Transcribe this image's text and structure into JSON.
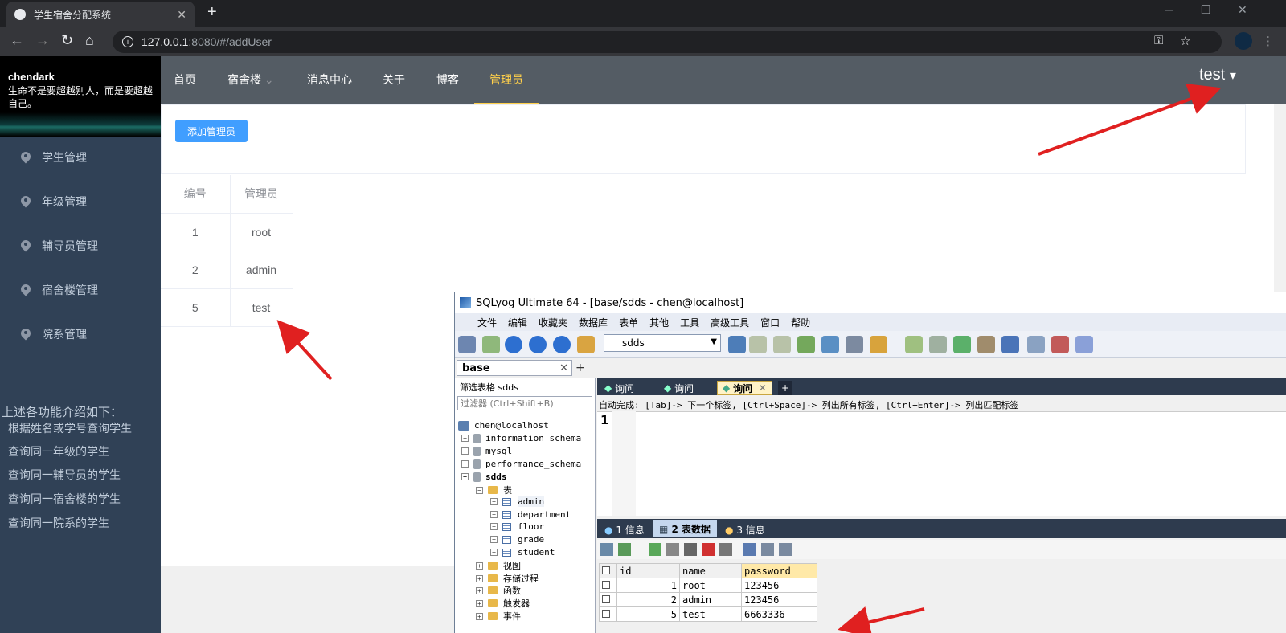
{
  "browser": {
    "tab_title": "学生宿舍分配系统",
    "tab_close": "✕",
    "new_tab": "+",
    "url_host": "127.0.0.1",
    "url_path": ":8080/#/addUser",
    "win_min": "─",
    "win_max": "❐",
    "win_close": "✕",
    "back": "←",
    "forward": "→",
    "reload": "↻",
    "home": "⌂",
    "key": "⚿",
    "star": "☆",
    "menu": "⋮"
  },
  "sidebar": {
    "brand": "chendark",
    "motto": "生命不是要超越别人，而是要超越自己。",
    "items": [
      {
        "label": "学生管理"
      },
      {
        "label": "年级管理"
      },
      {
        "label": "辅导员管理"
      },
      {
        "label": "宿舍楼管理"
      },
      {
        "label": "院系管理"
      }
    ],
    "intro": "上述各功能介绍如下：",
    "features": [
      "根据姓名或学号查询学生",
      "查询同一年级的学生",
      "查询同一辅导员的学生",
      "查询同一宿舍楼的学生",
      "查询同一院系的学生"
    ]
  },
  "nav": {
    "items": [
      "首页",
      "宿舍楼",
      "消息中心",
      "关于",
      "博客",
      "管理员"
    ],
    "dropdown_icon": "⌄",
    "user": "test",
    "user_caret": "▾"
  },
  "main": {
    "add_button": "添加管理员",
    "table": {
      "headers": [
        "编号",
        "管理员"
      ],
      "rows": [
        [
          "1",
          "root"
        ],
        [
          "2",
          "admin"
        ],
        [
          "5",
          "test"
        ]
      ]
    }
  },
  "sqlyog": {
    "title": "SQLyog Ultimate 64 - [base/sdds - chen@localhost]",
    "menu": [
      "文件",
      "编辑",
      "收藏夹",
      "数据库",
      "表单",
      "其他",
      "工具",
      "高级工具",
      "窗口",
      "帮助"
    ],
    "db_select": "sdds",
    "connection_tab": "base",
    "conn_close": "✕",
    "conn_plus": "+",
    "filter_label": "筛选表格 sdds",
    "filter_placeholder": "过滤器 (Ctrl+Shift+B)",
    "tree": {
      "host": "chen@localhost",
      "dbs": [
        "information_schema",
        "mysql",
        "performance_schema"
      ],
      "current_db": "sdds",
      "tables_folder": "表",
      "tables": [
        "admin",
        "department",
        "floor",
        "grade",
        "student"
      ],
      "folders": [
        "视图",
        "存储过程",
        "函数",
        "触发器",
        "事件"
      ]
    },
    "query_tabs": [
      "询问",
      "询问",
      "询问"
    ],
    "query_close": "✕",
    "query_plus": "+",
    "hint": "自动完成: [Tab]-> 下一个标签, [Ctrl+Space]-> 列出所有标签, [Ctrl+Enter]-> 列出匹配标签",
    "line_number": "1",
    "result_tabs": [
      "1 信息",
      "2 表数据",
      "3 信息"
    ],
    "grid": {
      "headers": [
        "id",
        "name",
        "password"
      ],
      "rows": [
        [
          "1",
          "root",
          "123456"
        ],
        [
          "2",
          "admin",
          "123456"
        ],
        [
          "5",
          "test",
          "6663336"
        ]
      ]
    }
  },
  "colors": {
    "sidebar": "#304156",
    "topnav": "#545c64",
    "active": "#ffd04b",
    "primary": "#409eff",
    "arrow": "#e02020"
  }
}
